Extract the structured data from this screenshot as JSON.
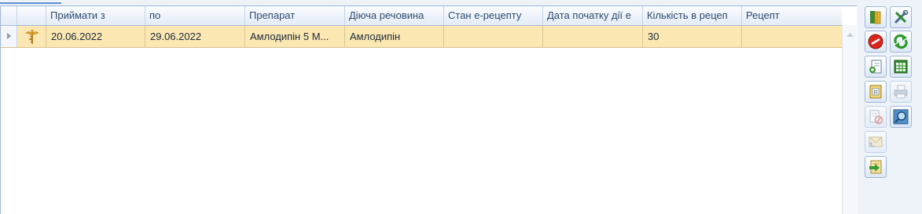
{
  "columns": [
    {
      "key": "take_from",
      "label": "Приймати з"
    },
    {
      "key": "to",
      "label": "по"
    },
    {
      "key": "drug",
      "label": "Препарат"
    },
    {
      "key": "substance",
      "label": "Діюча речовина"
    },
    {
      "key": "erx_status",
      "label": "Стан е-рецепту"
    },
    {
      "key": "start_date",
      "label": "Дата початку дії е"
    },
    {
      "key": "qty",
      "label": "Кількість в рецеп"
    },
    {
      "key": "rx",
      "label": "Рецепт"
    }
  ],
  "rows": [
    {
      "icon": "caduceus-icon",
      "take_from": "20.06.2022",
      "to": "29.06.2022",
      "drug": "Амлодипін 5 М...",
      "substance": "Амлодипін",
      "erx_status": "",
      "start_date": "",
      "qty": "30",
      "rx": ""
    }
  ],
  "toolbar": [
    {
      "name": "open-book-icon",
      "enabled": true
    },
    {
      "name": "tools-icon",
      "enabled": true
    },
    {
      "name": "cancel-icon",
      "enabled": true
    },
    {
      "name": "refresh-icon",
      "enabled": true
    },
    {
      "name": "add-document-icon",
      "enabled": true
    },
    {
      "name": "table-view-icon",
      "enabled": true
    },
    {
      "name": "prescription-form-icon",
      "enabled": true
    },
    {
      "name": "printer-icon",
      "enabled": false
    },
    {
      "name": "delete-document-icon",
      "enabled": false
    },
    {
      "name": "magnifier-icon",
      "enabled": true
    },
    {
      "name": "envelope-reply-icon",
      "enabled": false
    },
    {
      "name": "export-arrow-icon",
      "enabled": true
    }
  ]
}
